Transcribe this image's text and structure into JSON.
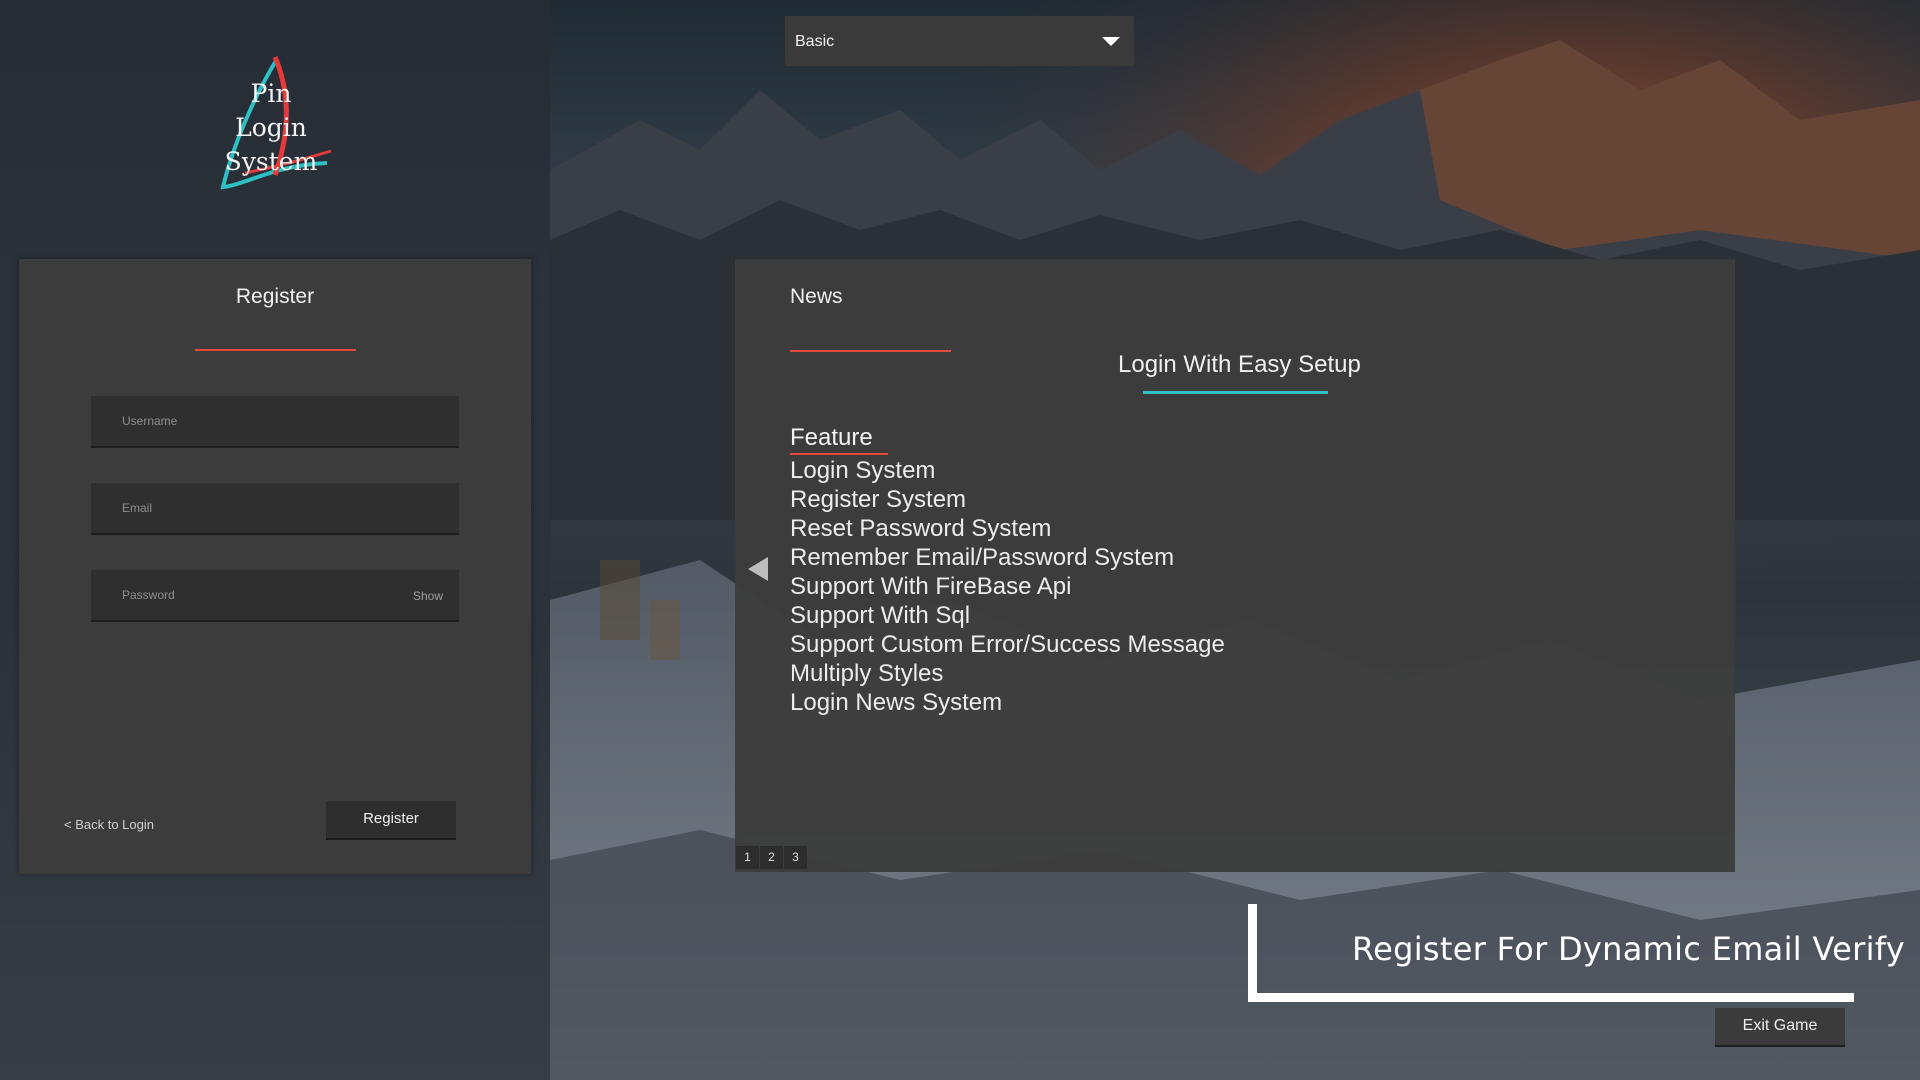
{
  "logo": {
    "lines": [
      "Pin",
      "Login",
      "System"
    ]
  },
  "register": {
    "title": "Register",
    "username_placeholder": "Username",
    "email_placeholder": "Email",
    "password_placeholder": "Password",
    "show_label": "Show",
    "back_label": "< Back to Login",
    "submit_label": "Register"
  },
  "dropdown": {
    "selected": "Basic"
  },
  "news": {
    "title": "News",
    "heading": "Login With Easy Setup",
    "feature_title": "Feature",
    "features": [
      "Login System",
      "Register System",
      "Reset Password System",
      "Remember Email/Password System",
      "Support With FireBase Api",
      "Support With Sql",
      "Support Custom Error/Success Message",
      "Multiply Styles",
      "Login News System"
    ],
    "pages": [
      "1",
      "2",
      "3"
    ]
  },
  "promo": {
    "text": "Register For Dynamic Email Verify"
  },
  "exit": {
    "label": "Exit Game"
  },
  "colors": {
    "accent_red": "#e24b3b",
    "accent_cyan": "#2ec0c4",
    "panel": "#3c3c3c"
  },
  "icons": {
    "dropdown": "caret-down-icon",
    "prev": "triangle-left-icon"
  }
}
